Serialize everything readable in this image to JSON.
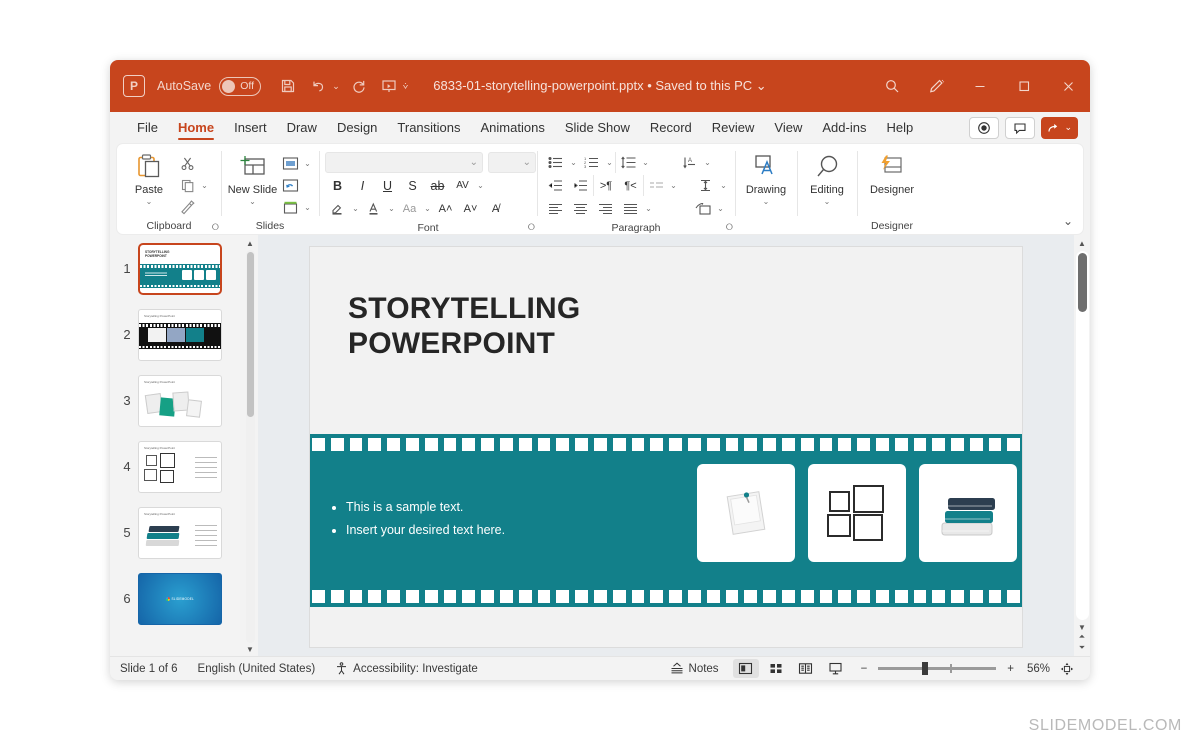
{
  "app": {
    "logo_icon": "powerpoint-logo-icon",
    "autosave_label": "AutoSave",
    "autosave_state": "Off",
    "document_title": "6833-01-storytelling-powerpoint.pptx • Saved to this PC ⌄",
    "accent_color": "#c7451d",
    "teal_color": "#12808a",
    "quick_access": [
      {
        "name": "save-icon",
        "label": "Save"
      },
      {
        "name": "undo-icon",
        "label": "Undo"
      },
      {
        "name": "redo-icon",
        "label": "Redo"
      },
      {
        "name": "start-presentation-icon",
        "label": "Start From Beginning"
      },
      {
        "name": "customize-quick-access-icon",
        "label": "Customize Quick Access Toolbar"
      }
    ],
    "title_right": [
      {
        "name": "search-icon",
        "label": "Search"
      },
      {
        "name": "ink-pen-icon",
        "label": "Ink"
      },
      {
        "name": "minimize-button",
        "label": "Minimize"
      },
      {
        "name": "maximize-button",
        "label": "Maximize"
      },
      {
        "name": "close-button",
        "label": "Close"
      }
    ]
  },
  "tabs": [
    {
      "label": "File",
      "active": false
    },
    {
      "label": "Home",
      "active": true
    },
    {
      "label": "Insert",
      "active": false
    },
    {
      "label": "Draw",
      "active": false
    },
    {
      "label": "Design",
      "active": false
    },
    {
      "label": "Transitions",
      "active": false
    },
    {
      "label": "Animations",
      "active": false
    },
    {
      "label": "Slide Show",
      "active": false
    },
    {
      "label": "Record",
      "active": false
    },
    {
      "label": "Review",
      "active": false
    },
    {
      "label": "View",
      "active": false
    },
    {
      "label": "Add-ins",
      "active": false
    },
    {
      "label": "Help",
      "active": false
    }
  ],
  "tabstrip_right": {
    "record_label": "Record",
    "comments_label": "Comments",
    "share_label": "Share"
  },
  "ribbon": {
    "groups": [
      {
        "label": "Clipboard",
        "big_button": "Paste",
        "small_buttons": [
          "Cut",
          "Copy",
          "Format Painter"
        ],
        "has_dialog_launcher": true
      },
      {
        "label": "Slides",
        "big_button": "New Slide",
        "small_buttons": [
          "Layout",
          "Reset",
          "Section"
        ],
        "has_dialog_launcher": false
      },
      {
        "label": "Font",
        "font_name_value": "",
        "font_name_placeholder": "",
        "font_size_value": "",
        "row1": [
          "Bold",
          "Italic",
          "Underline",
          "Text Shadow",
          "Strikethrough",
          "Character Spacing"
        ],
        "row2": [
          "Text Highlight Color",
          "Font Color",
          "Change Case",
          "Increase Font Size",
          "Decrease Font Size",
          "Clear All Formatting"
        ],
        "has_dialog_launcher": true
      },
      {
        "label": "Paragraph",
        "row1": [
          "Bullets",
          "Numbering",
          "Line Spacing",
          "Text Direction"
        ],
        "row2": [
          "Decrease Indent",
          "Increase Indent",
          "Align Text Left to Right",
          "Align Text Right to Left",
          "Align Text",
          "Convert to SmartArt"
        ],
        "row3": [
          "Align Left",
          "Center",
          "Align Right",
          "Justify",
          "Columns"
        ],
        "has_dialog_launcher": true
      },
      {
        "label": "",
        "big_button": "Drawing",
        "has_dialog_launcher": false
      },
      {
        "label": "",
        "big_button": "Editing",
        "has_dialog_launcher": false
      },
      {
        "label": "Designer",
        "big_button": "Designer",
        "has_dialog_launcher": false
      }
    ],
    "collapse_label": "Collapse the Ribbon"
  },
  "thumbnails": [
    {
      "number": "1",
      "selected": true,
      "kind": "title-filmstrip"
    },
    {
      "number": "2",
      "selected": false,
      "kind": "filmstrip-three"
    },
    {
      "number": "3",
      "selected": false,
      "kind": "polaroids"
    },
    {
      "number": "4",
      "selected": false,
      "kind": "frames-grid"
    },
    {
      "number": "5",
      "selected": false,
      "kind": "books"
    },
    {
      "number": "6",
      "selected": false,
      "kind": "closing-blue"
    }
  ],
  "slide": {
    "title_line1": "STORYTELLING",
    "title_line2": "POWERPOINT",
    "bullets": [
      "This is a sample text.",
      "Insert your desired text here."
    ],
    "cards": [
      {
        "name": "pinned-photo-icon",
        "label": "Pinned photo"
      },
      {
        "name": "photo-gallery-icon",
        "label": "Photo frames"
      },
      {
        "name": "book-stack-icon",
        "label": "Stack of books"
      }
    ]
  },
  "status_bar": {
    "slide_counter": "Slide 1 of 6",
    "language": "English (United States)",
    "accessibility": "Accessibility: Investigate",
    "notes_label": "Notes",
    "views": [
      {
        "name": "normal-view",
        "label": "Normal",
        "active": true
      },
      {
        "name": "slide-sorter-view",
        "label": "Slide Sorter",
        "active": false
      },
      {
        "name": "reading-view",
        "label": "Reading View",
        "active": false
      },
      {
        "name": "slide-show-view",
        "label": "Slide Show",
        "active": false
      }
    ],
    "zoom_out": "−",
    "zoom_in": "+",
    "zoom_value": "56%",
    "fit_label": "Fit slide to current window"
  },
  "watermark": "SLIDEMODEL.COM"
}
